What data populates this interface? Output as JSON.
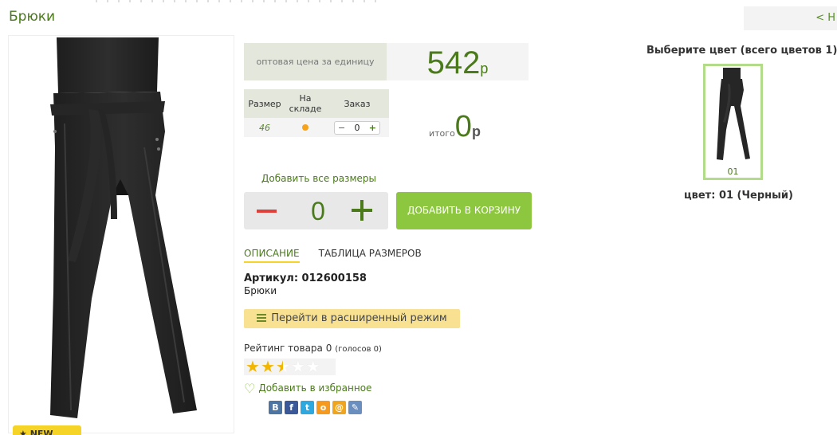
{
  "page": {
    "title": "Брюки",
    "back_link": "< Н"
  },
  "product_image": {
    "alt": "Брюки",
    "badge": "★ NEW"
  },
  "price": {
    "label": "оптовая цена за единицу",
    "value": "542",
    "currency": "р"
  },
  "size_table": {
    "headers": [
      "Размер",
      "На складе",
      "Заказ"
    ],
    "rows": [
      {
        "size": "46",
        "in_stock": true,
        "order_qty": "0"
      }
    ]
  },
  "total": {
    "label": "итого",
    "value": "0",
    "currency": "р"
  },
  "add_all_sizes": "Добавить все размеры",
  "quantity": "0",
  "add_to_cart": "ДОБАВИТЬ В КОРЗИНУ",
  "tabs": [
    {
      "label": "ОПИСАНИЕ",
      "active": true
    },
    {
      "label": "ТАБЛИЦА РАЗМЕРОВ",
      "active": false
    }
  ],
  "sku": "Артикул: 012600158",
  "sku_desc": "Брюки",
  "advanced_mode": "Перейти в расширенный режим",
  "rating": {
    "label": "Рейтинг товара 0",
    "votes": "(голосов 0)",
    "stars": 2.5,
    "max": 5
  },
  "favorite": "Добавить в избранное",
  "share": [
    {
      "icon": "vk-icon",
      "glyph": "В",
      "color": "#4c75a3"
    },
    {
      "icon": "facebook-icon",
      "glyph": "f",
      "color": "#3b5998"
    },
    {
      "icon": "twitter-icon",
      "glyph": "t",
      "color": "#2fa8e0"
    },
    {
      "icon": "odnoklassniki-icon",
      "glyph": "о",
      "color": "#f59a1f"
    },
    {
      "icon": "mailru-icon",
      "glyph": "@",
      "color": "#f0a51f"
    },
    {
      "icon": "livejournal-icon",
      "glyph": "✎",
      "color": "#6a8fbf"
    }
  ],
  "colors": {
    "heading": "Выберите цвет (всего цветов 1)",
    "swatch_number": "01",
    "selected_name": "цвет: 01 (Черный)"
  },
  "theme": {
    "accent": "#4a7a1a",
    "button": "#8dc63f",
    "highlight": "#f5d327"
  }
}
